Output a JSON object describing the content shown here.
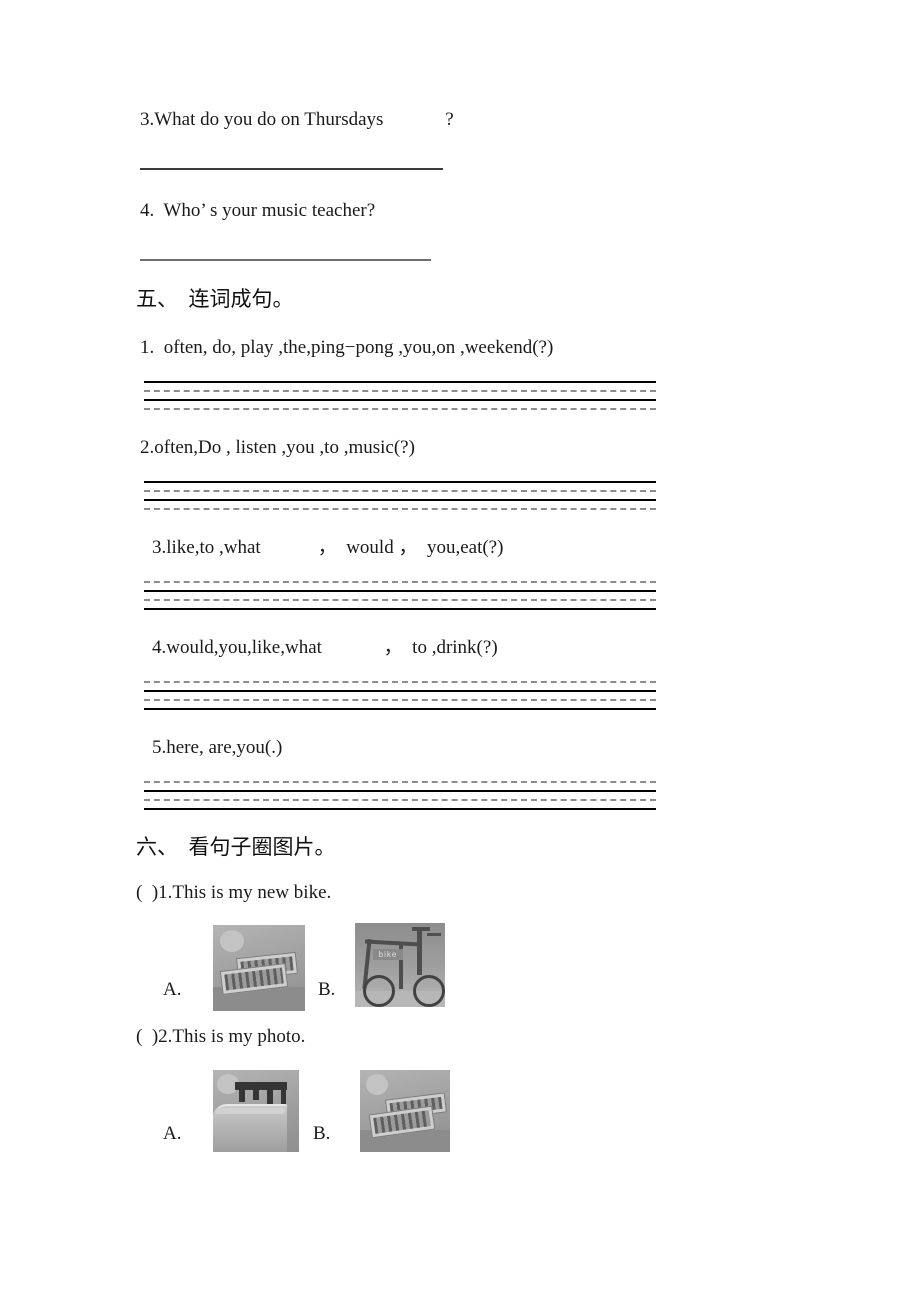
{
  "document": {
    "questions_carryover": [
      {
        "id": "q3",
        "text": "3.What do you do on Thursdays             ?"
      },
      {
        "id": "q4",
        "text": "4.  Who’ s your music teacher?"
      }
    ],
    "section_five": {
      "heading": "五、  连词成句。",
      "items": [
        {
          "num": "1",
          "text": "1.  often, do, play ,the,ping−pong ,you,on ,weekend(?)"
        },
        {
          "num": "2",
          "text": "2.often,Do , listen ,you ,to ,music(?)"
        },
        {
          "num": "3",
          "text": "3.like,to ,what            ，  would ，  you,eat(?)"
        },
        {
          "num": "4",
          "text": "4.would,you,like,what             ，  to ,drink(?)"
        },
        {
          "num": "5",
          "text": "5.here, are,you(.)"
        }
      ]
    },
    "section_six": {
      "heading": "六、  看句子圈图片。",
      "items": [
        {
          "prompt": "(  )1.This is my new bike.",
          "options": [
            {
              "label": "A.",
              "picture": "photos-on-table"
            },
            {
              "label": "B.",
              "picture": "bicycle"
            }
          ]
        },
        {
          "prompt": "(  )2.This is my photo.",
          "options": [
            {
              "label": "A.",
              "picture": "bed-headboard"
            },
            {
              "label": "B.",
              "picture": "photos-on-table"
            }
          ]
        }
      ]
    },
    "bike_plate_text": "bike",
    "colors": {
      "text": "#1a1a1a",
      "rule_solid": "#000000",
      "rule_dashed": "#8d8d8d",
      "blank": "#3a3a3a",
      "page_background": "#ffffff"
    }
  }
}
